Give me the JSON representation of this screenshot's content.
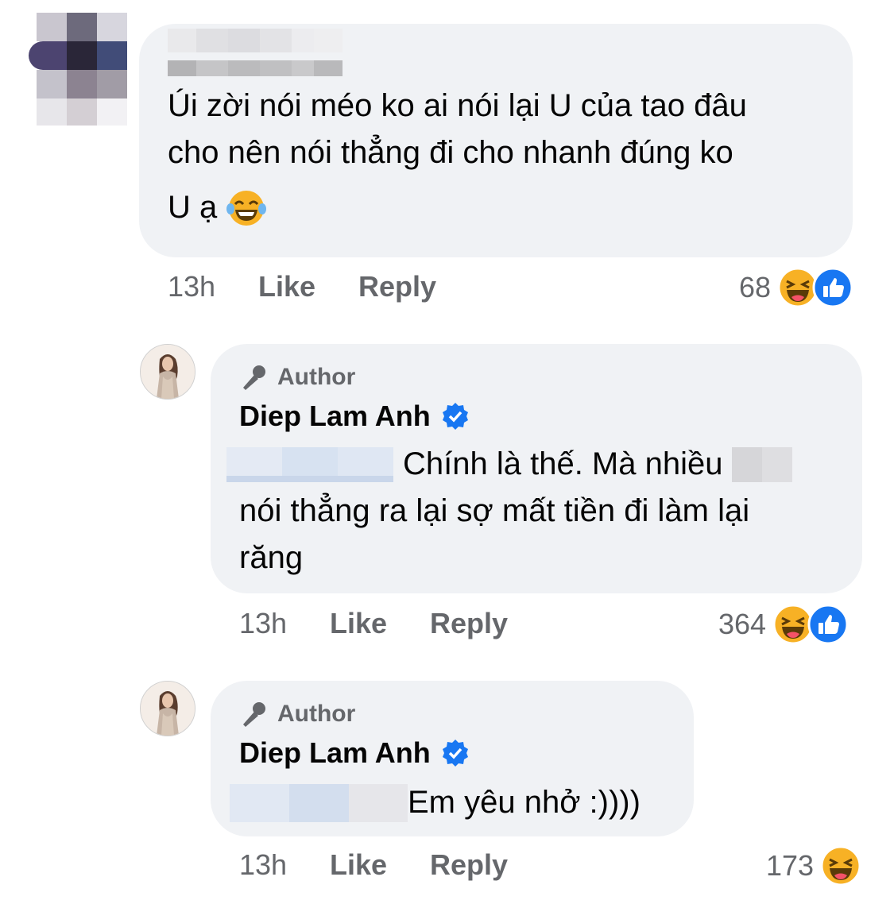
{
  "comments": [
    {
      "text_line1": "Úi zời nói méo ko ai nói lại U của tao đâu",
      "text_line2": "cho nên nói thẳng đi cho nhanh đúng ko",
      "text_line3": "U ạ",
      "time": "13h",
      "like_label": "Like",
      "reply_label": "Reply",
      "reaction_count": "68",
      "reactions": [
        "haha",
        "like"
      ]
    },
    {
      "author_badge": "Author",
      "name": "Diep Lam Anh",
      "verified": true,
      "text_line1": "Chính là thế. Mà nhiều",
      "text_line2": "nói thẳng ra lại sợ mất tiền đi làm lại",
      "text_line3": "răng",
      "time": "13h",
      "like_label": "Like",
      "reply_label": "Reply",
      "reaction_count": "364",
      "reactions": [
        "haha",
        "like"
      ]
    },
    {
      "author_badge": "Author",
      "name": "Diep Lam Anh",
      "verified": true,
      "text_line1": "Em yêu nhở :))))",
      "time": "13h",
      "like_label": "Like",
      "reply_label": "Reply",
      "reaction_count": "173",
      "reactions": [
        "haha"
      ]
    }
  ],
  "colors": {
    "bubble": "#f0f2f5",
    "secondary_text": "#65676b",
    "verified_blue": "#1877f2",
    "like_blue": "#1877f2",
    "haha_yellow": "#f7b125"
  }
}
